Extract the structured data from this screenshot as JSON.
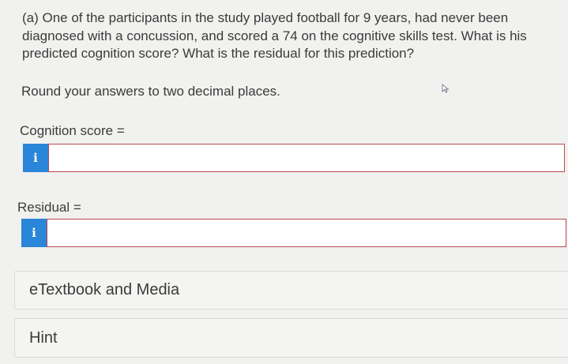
{
  "question": {
    "text": "(a) One of the participants in the study played football for 9 years, had never been diagnosed with a concussion, and scored a 74 on the cognitive skills test. What is his predicted cognition score? What is the residual for this prediction?"
  },
  "instruction": "Round your answers to two decimal places.",
  "fields": {
    "cognition": {
      "label": "Cognition score =",
      "info_glyph": "i",
      "value": ""
    },
    "residual": {
      "label": "Residual =",
      "info_glyph": "i",
      "value": ""
    }
  },
  "panels": {
    "etextbook": "eTextbook and Media",
    "hint": "Hint"
  },
  "colors": {
    "info_button": "#2a86d8",
    "input_border": "#b94852",
    "background": "#f1f1ef"
  },
  "icons": {
    "info": "info-icon",
    "cursor": "mouse-cursor-icon"
  }
}
